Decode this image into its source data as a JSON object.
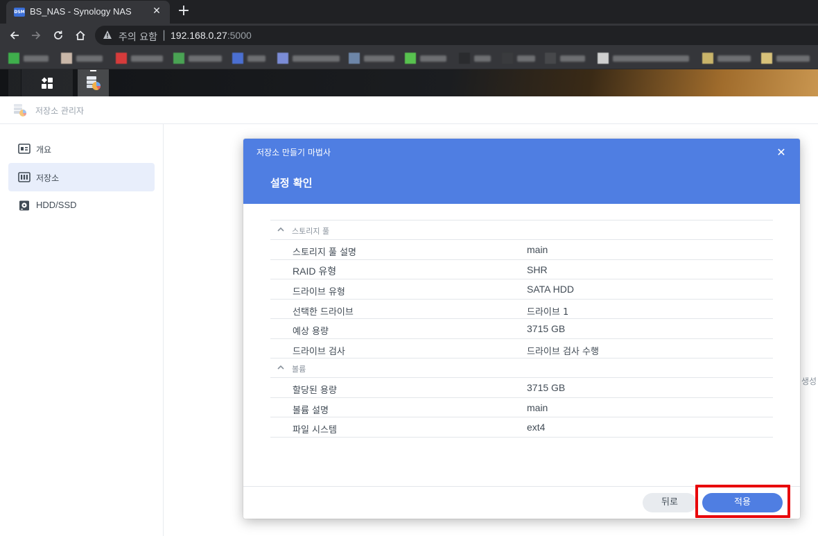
{
  "browser": {
    "tab_title": "BS_NAS - Synology NAS",
    "tab_favicon_text": "DSM",
    "close_symbol": "✕",
    "new_tab_symbol": "+",
    "security_label": "주의 요함",
    "url_host": "192.168.0.27",
    "url_port": ":5000",
    "url_separator": "|",
    "nav": {
      "back_icon": "arrow-left-icon",
      "forward_icon": "arrow-right-icon",
      "reload_icon": "reload-icon",
      "home_icon": "home-icon"
    },
    "bookmark_count_note": "blurred bookmarks"
  },
  "app": {
    "title": "저장소 관리자",
    "sidebar": [
      {
        "label": "개요",
        "icon": "overview-icon",
        "active": false
      },
      {
        "label": "저장소",
        "icon": "storage-icon",
        "active": true
      },
      {
        "label": "HDD/SSD",
        "icon": "hdd-icon",
        "active": false
      }
    ],
    "background_text": "생성"
  },
  "dialog": {
    "wizard_title": "저장소 만들기 마법사",
    "close_symbol": "✕",
    "step_title": "설정 확인",
    "sections": [
      {
        "title": "스토리지 풀",
        "rows": [
          {
            "label": "스토리지 풀 설명",
            "value": "main"
          },
          {
            "label": "RAID 유형",
            "value": "SHR"
          },
          {
            "label": "드라이브 유형",
            "value": "SATA HDD"
          },
          {
            "label": "선택한 드라이브",
            "value": "드라이브 1"
          },
          {
            "label": "예상 용량",
            "value": "3715 GB"
          },
          {
            "label": "드라이브 검사",
            "value": "드라이브 검사 수행"
          }
        ]
      },
      {
        "title": "볼륨",
        "rows": [
          {
            "label": "할당된 용량",
            "value": "3715 GB"
          },
          {
            "label": "볼륨 설명",
            "value": "main"
          },
          {
            "label": "파일 시스템",
            "value": "ext4"
          }
        ]
      }
    ],
    "buttons": {
      "back": "뒤로",
      "apply": "적용"
    }
  },
  "colors": {
    "accent": "#4f7ee2",
    "highlight": "#e8060b",
    "sidebar_active": "#e8eefb"
  }
}
